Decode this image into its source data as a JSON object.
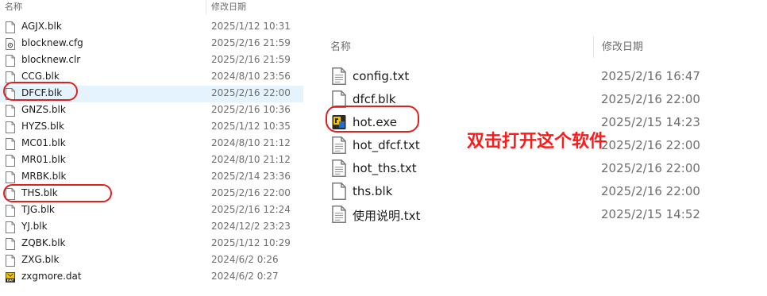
{
  "left_pane": {
    "col_name": "名称",
    "col_date": "修改日期",
    "files": [
      {
        "name": "AGJX.blk",
        "date": "2025/1/12 10:31",
        "icon": "document-icon"
      },
      {
        "name": "blocknew.cfg",
        "date": "2025/2/16 21:59",
        "icon": "settings-file-icon"
      },
      {
        "name": "blocknew.clr",
        "date": "2025/2/16 21:59",
        "icon": "document-icon"
      },
      {
        "name": "CCG.blk",
        "date": "2024/8/10 23:56",
        "icon": "document-icon"
      },
      {
        "name": "DFCF.blk",
        "date": "2025/2/16 22:00",
        "icon": "document-icon"
      },
      {
        "name": "GNZS.blk",
        "date": "2025/2/16 10:36",
        "icon": "document-icon"
      },
      {
        "name": "HYZS.blk",
        "date": "2025/1/12 10:35",
        "icon": "document-icon"
      },
      {
        "name": "MC01.blk",
        "date": "2024/8/10 21:12",
        "icon": "document-icon"
      },
      {
        "name": "MR01.blk",
        "date": "2024/8/10 21:12",
        "icon": "document-icon"
      },
      {
        "name": "MRBK.blk",
        "date": "2025/2/14 23:36",
        "icon": "document-icon"
      },
      {
        "name": "THS.blk",
        "date": "2025/2/16 22:00",
        "icon": "document-icon"
      },
      {
        "name": "TJG.blk",
        "date": "2025/2/16 12:24",
        "icon": "document-icon"
      },
      {
        "name": "YJ.blk",
        "date": "2024/12/2 23:23",
        "icon": "document-icon"
      },
      {
        "name": "ZQBK.blk",
        "date": "2025/1/12 10:29",
        "icon": "document-icon"
      },
      {
        "name": "ZXG.blk",
        "date": "2024/6/2 0:26",
        "icon": "document-icon"
      },
      {
        "name": "zxgmore.dat",
        "date": "2024/6/2 0:27",
        "icon": "dat-file-icon"
      }
    ],
    "highlighted_file": "DFCF.blk",
    "circled_files": [
      "DFCF.blk",
      "THS.blk"
    ]
  },
  "right_pane": {
    "col_name": "名称",
    "col_date": "修改日期",
    "files": [
      {
        "name": "config.txt",
        "date": "2025/2/16 16:47",
        "icon": "text-file-icon"
      },
      {
        "name": "dfcf.blk",
        "date": "2025/2/16 22:00",
        "icon": "document-icon"
      },
      {
        "name": "hot.exe",
        "date": "2025/2/15 14:23",
        "icon": "exe-app-icon"
      },
      {
        "name": "hot_dfcf.txt",
        "date": "2025/2/16 22:00",
        "icon": "text-file-icon"
      },
      {
        "name": "hot_ths.txt",
        "date": "2025/2/16 22:00",
        "icon": "text-file-icon"
      },
      {
        "name": "ths.blk",
        "date": "2025/2/16 22:00",
        "icon": "document-icon"
      },
      {
        "name": "使用说明.txt",
        "date": "2025/2/15 14:52",
        "icon": "text-file-icon"
      }
    ],
    "circled_files": [
      "hot.exe"
    ]
  },
  "annotation": {
    "text": "双击打开这个软件",
    "color": "#ff1a1a"
  },
  "colors": {
    "highlight": "#e5f3ff",
    "circle": "#e02020",
    "header_text": "#6d6d6d"
  }
}
